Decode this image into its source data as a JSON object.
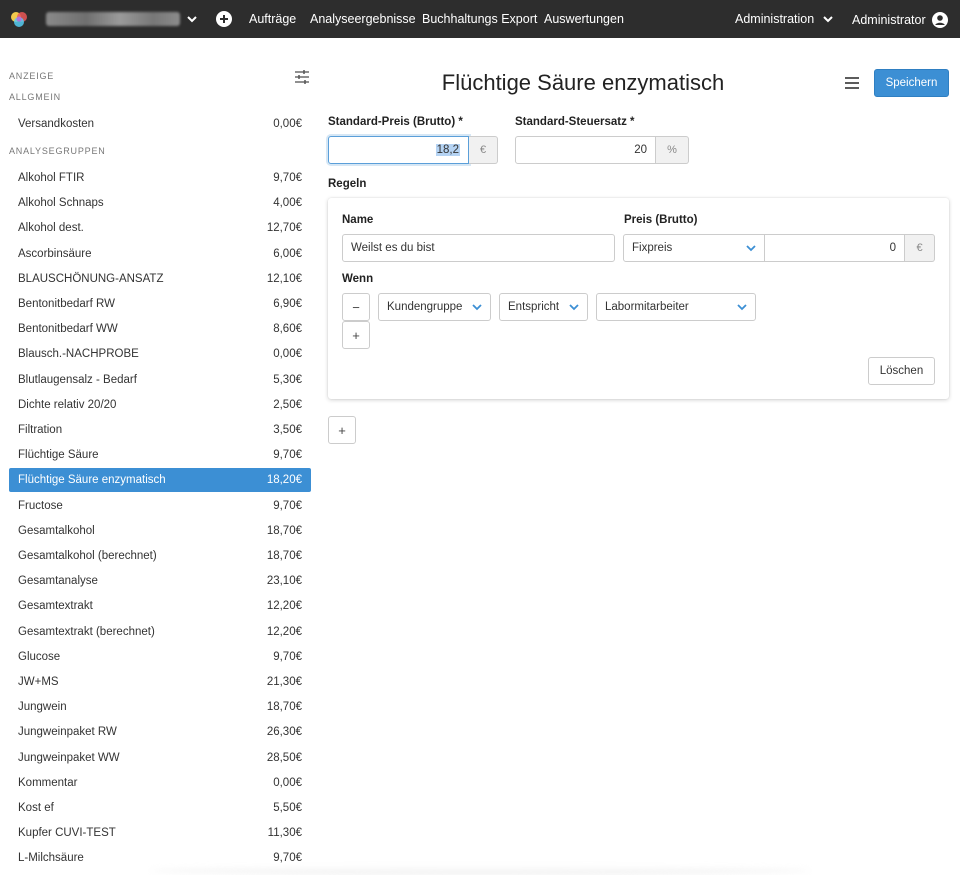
{
  "colors": {
    "topbar_bg": "#2d2d2d",
    "accent": "#3c8fd4"
  },
  "topbar": {
    "nav": [
      "Aufträge",
      "Analyseergebnisse",
      "Buchhaltungs Export",
      "Auswertungen"
    ],
    "admin_menu": "Administration",
    "user": "Administrator",
    "icons": [
      "app-logo",
      "chevron-down-icon",
      "plus-circle-icon",
      "user-circle-icon"
    ]
  },
  "sidebar": {
    "label_display": "ANZEIGE",
    "label_general": "ALLGMEIN",
    "label_groups": "ANALYSEGRUPPEN",
    "general_items": [
      {
        "name": "Versandkosten",
        "price": "0,00€"
      }
    ],
    "group_items": [
      {
        "name": "Alkohol FTIR",
        "price": "9,70€"
      },
      {
        "name": "Alkohol Schnaps",
        "price": "4,00€"
      },
      {
        "name": "Alkohol dest.",
        "price": "12,70€"
      },
      {
        "name": "Ascorbinsäure",
        "price": "6,00€"
      },
      {
        "name": "BLAUSCHÖNUNG-ANSATZ",
        "price": "12,10€"
      },
      {
        "name": "Bentonitbedarf RW",
        "price": "6,90€"
      },
      {
        "name": "Bentonitbedarf WW",
        "price": "8,60€"
      },
      {
        "name": "Blausch.-NACHPROBE",
        "price": "0,00€"
      },
      {
        "name": "Blutlaugensalz - Bedarf",
        "price": "5,30€"
      },
      {
        "name": "Dichte relativ 20/20",
        "price": "2,50€"
      },
      {
        "name": "Filtration",
        "price": "3,50€"
      },
      {
        "name": "Flüchtige Säure",
        "price": "9,70€"
      },
      {
        "name": "Flüchtige Säure enzymatisch",
        "price": "18,20€"
      },
      {
        "name": "Fructose",
        "price": "9,70€"
      },
      {
        "name": "Gesamtalkohol",
        "price": "18,70€"
      },
      {
        "name": "Gesamtalkohol (berechnet)",
        "price": "18,70€"
      },
      {
        "name": "Gesamtanalyse",
        "price": "23,10€"
      },
      {
        "name": "Gesamtextrakt",
        "price": "12,20€"
      },
      {
        "name": "Gesamtextrakt (berechnet)",
        "price": "12,20€"
      },
      {
        "name": "Glucose",
        "price": "9,70€"
      },
      {
        "name": "JW+MS",
        "price": "21,30€"
      },
      {
        "name": "Jungwein",
        "price": "18,70€"
      },
      {
        "name": "Jungweinpaket RW",
        "price": "26,30€"
      },
      {
        "name": "Jungweinpaket WW",
        "price": "28,50€"
      },
      {
        "name": "Kommentar",
        "price": "0,00€"
      },
      {
        "name": "Kost ef",
        "price": "5,50€"
      },
      {
        "name": "Kupfer CUVI-TEST",
        "price": "11,30€"
      },
      {
        "name": "L-Milchsäure",
        "price": "9,70€"
      }
    ],
    "active_name": "Flüchtige Säure enzymatisch"
  },
  "main": {
    "title": "Flüchtige Säure enzymatisch",
    "save_label": "Speichern",
    "price_label": "Standard-Preis (Brutto) *",
    "price_value": "18,2",
    "price_unit": "€",
    "tax_label": "Standard-Steuersatz *",
    "tax_value": "20",
    "tax_unit": "%",
    "rules_label": "Regeln",
    "rule": {
      "name_label": "Name",
      "name_value": "Weilst es du bist",
      "price_label": "Preis (Brutto)",
      "price_type": "Fixpreis",
      "price_value": "0",
      "price_unit": "€",
      "when_label": "Wenn",
      "remove_symbol": "−",
      "add_symbol": "+",
      "condition_field": "Kundengruppe",
      "condition_operator": "Entspricht",
      "condition_value": "Labormitarbeiter",
      "delete_label": "Löschen"
    },
    "add_rule_symbol": "+"
  }
}
